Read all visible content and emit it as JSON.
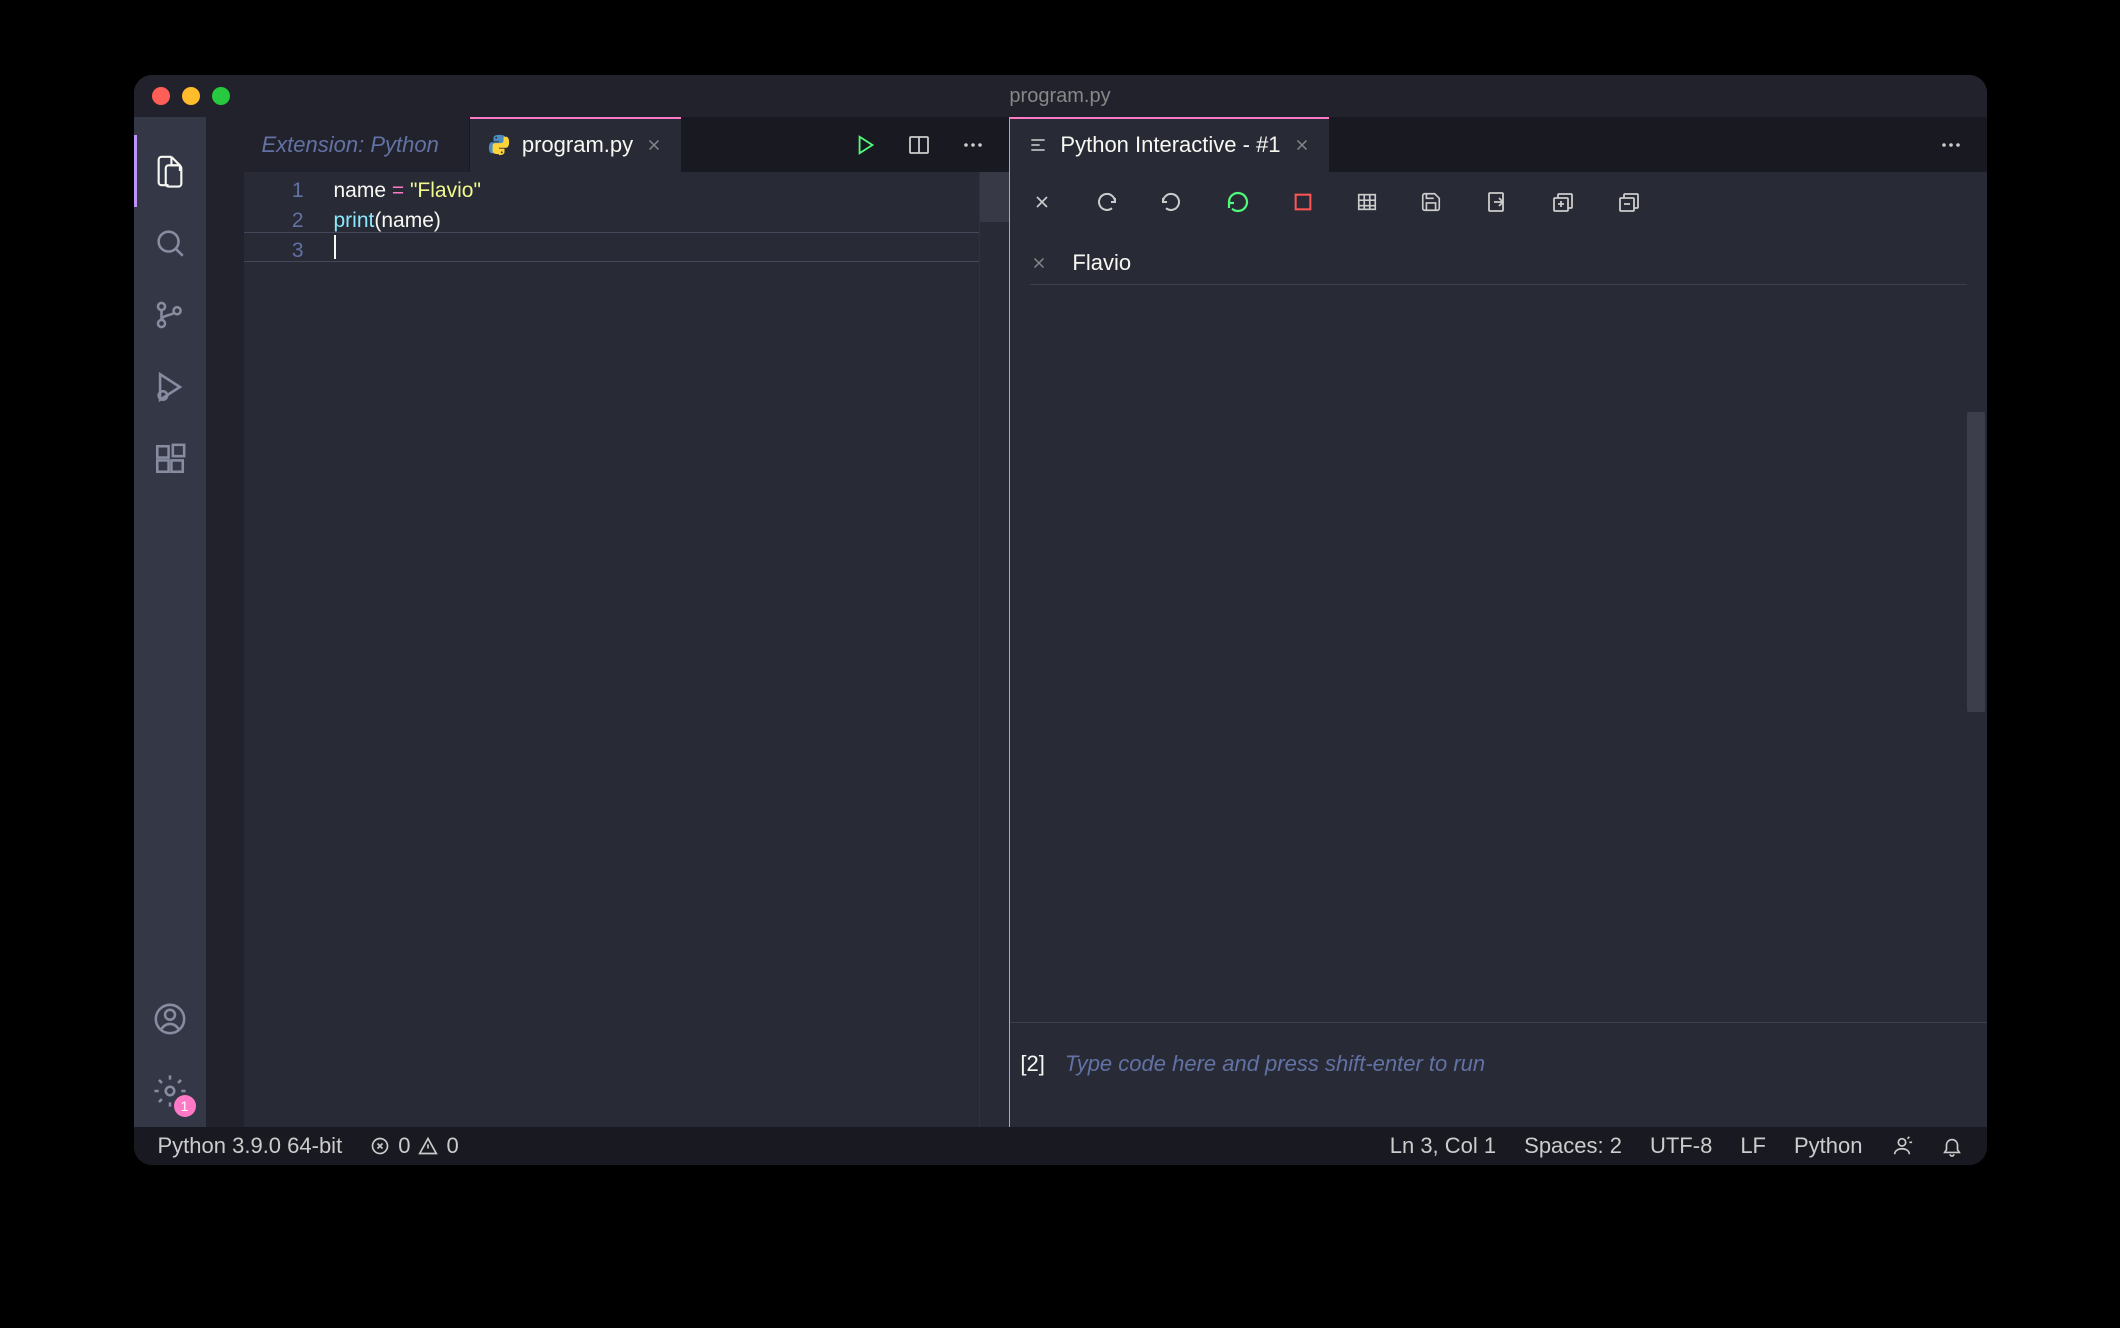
{
  "window": {
    "title": "program.py"
  },
  "tabs": {
    "left_inactive": "Extension: Python",
    "left_active": "program.py",
    "right_active": "Python Interactive - #1"
  },
  "code": {
    "lines": [
      "1",
      "2",
      "3"
    ],
    "line1_var": "name",
    "line1_eq": " = ",
    "line1_str": "\"Flavio\"",
    "line2_fn": "print",
    "line2_open": "(",
    "line2_arg": "name",
    "line2_close": ")"
  },
  "interactive": {
    "output": "Flavio",
    "input_num": "[2]",
    "input_placeholder": "Type code here and press shift-enter to run"
  },
  "statusbar": {
    "interpreter": "Python 3.9.0 64-bit",
    "errors": "0",
    "warnings": "0",
    "cursor": "Ln 3, Col 1",
    "spaces": "Spaces: 2",
    "encoding": "UTF-8",
    "eol": "LF",
    "language": "Python"
  },
  "activity": {
    "settings_badge": "1"
  }
}
